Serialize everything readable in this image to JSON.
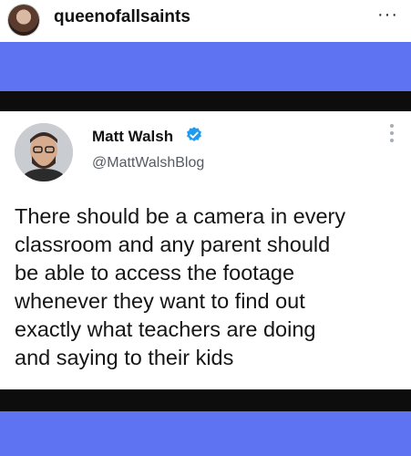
{
  "instagram": {
    "username": "queenofallsaints",
    "more_icon": "ellipsis-icon"
  },
  "tweet": {
    "author_name": "Matt Walsh",
    "handle": "@MattWalshBlog",
    "verified_icon": "verified-badge-icon",
    "text": "There should be a camera in every\nclassroom and any parent should\nbe able to access the footage\nwhenever they want to find out\nexactly what teachers are doing\nand saying to their kids"
  },
  "colors": {
    "background_blue": "#5e73f2",
    "band_black": "#0d0d0d",
    "verified_blue": "#1d9bf0"
  }
}
